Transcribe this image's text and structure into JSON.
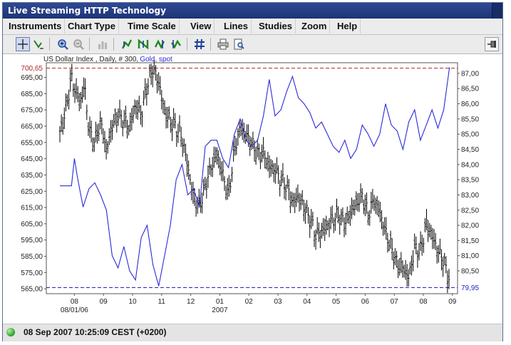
{
  "window": {
    "title": "Live Streaming HTTP Technology"
  },
  "menu": {
    "items": [
      "Instruments",
      "Chart Type",
      "Time Scale",
      "View",
      "Lines",
      "Studies",
      "Zoom",
      "Help"
    ]
  },
  "toolbar": {
    "icons": [
      "crosshair-icon",
      "draw-line-icon",
      "zoom-in-icon",
      "zoom-out-icon",
      "bar-chart-icon",
      "chart-type-icon-1",
      "chart-type-icon-2",
      "chart-type-icon-3",
      "chart-type-icon-4",
      "grid-icon",
      "print-icon",
      "print-preview-icon",
      "pin-icon"
    ],
    "active": "crosshair-icon"
  },
  "status": {
    "datetime": "08 Sep 2007 10:25:09  CEST (+0200)",
    "indicator_color": "#2a9f2a"
  },
  "chart_data": {
    "type": "line",
    "header": {
      "instrument": "US Dollar Index , Daily, # 300, ",
      "overlay": "Gold, spot"
    },
    "x_ticks": [
      "08",
      "09",
      "10",
      "11",
      "12",
      "01",
      "02",
      "03",
      "04",
      "05",
      "06",
      "07",
      "08",
      "09"
    ],
    "x_year_labels": [
      {
        "under": 0,
        "text": "08/01/06"
      },
      {
        "under": 5,
        "text": "2007"
      }
    ],
    "y_left": {
      "ticks": [
        "695,00",
        "685,00",
        "675,00",
        "665,00",
        "655,00",
        "645,00",
        "635,00",
        "625,00",
        "615,00",
        "605,00",
        "595,00",
        "585,00",
        "575,00",
        "565,00"
      ],
      "range": [
        562,
        704
      ],
      "current_label": "700,65",
      "current_value": 700.65,
      "current_color": "#b22222"
    },
    "y_right": {
      "ticks": [
        "87,00",
        "86,50",
        "86,00",
        "85,50",
        "85,00",
        "84,50",
        "84,00",
        "83,50",
        "83,00",
        "82,50",
        "82,00",
        "81,50",
        "81,00",
        "80,50"
      ],
      "range": [
        79.75,
        87.35
      ],
      "current_label": "79,95",
      "current_value": 79.95,
      "current_color": "#2222cc"
    },
    "series": [
      {
        "axis": "left",
        "style": "ohlc",
        "color": "#000000",
        "months": [
          0,
          0.2,
          0.4,
          0.5,
          0.7,
          0.85,
          1.0,
          1.2,
          1.4,
          1.6,
          1.8,
          2.0,
          2.2,
          2.4,
          2.6,
          2.8,
          3.0,
          3.2,
          3.4,
          3.6,
          3.8,
          4.0,
          4.2,
          4.4,
          4.6,
          4.8,
          5.0,
          5.2,
          5.4,
          5.6,
          5.8,
          6.0,
          6.2,
          6.4,
          6.6,
          6.8,
          7.0,
          7.2,
          7.4,
          7.6,
          7.8,
          8.0,
          8.2,
          8.4,
          8.6,
          8.8,
          9.0,
          9.2,
          9.4,
          9.6,
          9.8,
          10.0,
          10.2,
          10.4,
          10.6,
          10.8,
          11.0,
          11.2,
          11.4,
          11.6,
          11.8,
          12.0,
          12.2,
          12.4,
          12.6,
          12.8,
          13.0,
          13.2,
          13.4
        ],
        "values": [
          660,
          675,
          695,
          688,
          680,
          690,
          662,
          655,
          668,
          650,
          665,
          672,
          668,
          664,
          678,
          672,
          690,
          700,
          692,
          674,
          668,
          664,
          658,
          640,
          620,
          616,
          628,
          640,
          648,
          635,
          622,
          650,
          664,
          660,
          654,
          648,
          648,
          640,
          638,
          632,
          628,
          618,
          622,
          615,
          608,
          598,
          600,
          604,
          608,
          610,
          605,
          612,
          618,
          622,
          610,
          620,
          612,
          600,
          590,
          580,
          578,
          572,
          590,
          588,
          605,
          598,
          588,
          582,
          570
        ]
      },
      {
        "axis": "right",
        "style": "line",
        "color": "#2a2ad9",
        "months": [
          0,
          0.2,
          0.4,
          0.5,
          0.6,
          0.8,
          1.0,
          1.2,
          1.4,
          1.6,
          1.8,
          2.0,
          2.2,
          2.4,
          2.6,
          2.8,
          3.0,
          3.2,
          3.4,
          3.6,
          3.8,
          4.0,
          4.2,
          4.4,
          4.6,
          4.8,
          5.0,
          5.2,
          5.4,
          5.6,
          5.8,
          6.0,
          6.2,
          6.4,
          6.6,
          6.8,
          7.0,
          7.2,
          7.4,
          7.6,
          7.8,
          8.0,
          8.2,
          8.4,
          8.6,
          8.8,
          9.0,
          9.2,
          9.4,
          9.6,
          9.8,
          10.0,
          10.2,
          10.4,
          10.6,
          10.8,
          11.0,
          11.2,
          11.4,
          11.6,
          11.8,
          12.0,
          12.2,
          12.4,
          12.6,
          12.8,
          13.0,
          13.2,
          13.4
        ],
        "values": [
          83.3,
          83.3,
          83.3,
          84.2,
          83.6,
          82.6,
          83.2,
          83.4,
          83.0,
          82.5,
          81.0,
          80.6,
          81.3,
          80.5,
          80.2,
          81.6,
          82.0,
          80.7,
          80.0,
          81.0,
          82.0,
          83.5,
          84.0,
          83.0,
          83.2,
          82.6,
          84.6,
          84.8,
          84.8,
          84.2,
          83.9,
          85.0,
          85.5,
          84.8,
          84.6,
          84.8,
          85.6,
          86.8,
          85.6,
          85.8,
          86.4,
          86.9,
          86.2,
          86.0,
          85.7,
          85.2,
          85.4,
          85.0,
          84.6,
          84.4,
          84.8,
          84.2,
          84.5,
          85.3,
          85.0,
          84.6,
          85.0,
          86.0,
          85.3,
          85.1,
          84.5,
          85.4,
          85.8,
          84.8,
          85.3,
          85.8,
          85.2,
          85.8,
          87.2
        ]
      }
    ],
    "legend": "none",
    "grid": false
  }
}
